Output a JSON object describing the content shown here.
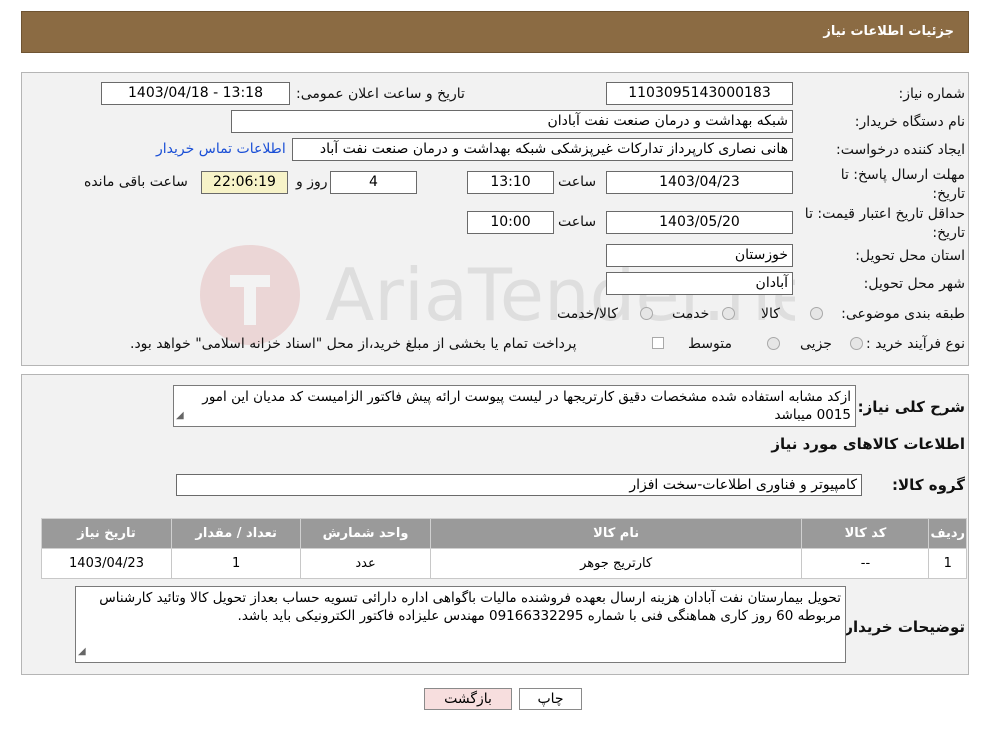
{
  "header": {
    "title": "جزئیات اطلاعات نیاز"
  },
  "need": {
    "number_label": "شماره نیاز:",
    "number": "1103095143000183",
    "announce_label": "تاریخ و ساعت اعلان عمومی:",
    "announce_value": "1403/04/18 - 13:18",
    "buyer_org_label": "نام دستگاه خریدار:",
    "buyer_org": "شبکه بهداشت و درمان صنعت نفت آبادان",
    "requester_label": "ایجاد کننده درخواست:",
    "requester": "هانی نصاری کارپرداز تدارکات غیرپزشکی شبکه بهداشت و درمان صنعت نفت آباد",
    "contact_link": "اطلاعات تماس خریدار",
    "deadline_label": "مهلت ارسال پاسخ: تا تاریخ:",
    "deadline_date": "1403/04/23",
    "time_label": "ساعت",
    "deadline_time": "13:10",
    "remaining_days": "4",
    "day_label": "روز و",
    "remaining_time": "22:06:19",
    "remaining_label": "ساعت باقی مانده",
    "validity_label": "حداقل تاریخ اعتبار قیمت: تا تاریخ:",
    "validity_date": "1403/05/20",
    "validity_time": "10:00",
    "province_label": "استان محل تحویل:",
    "province": "خوزستان",
    "city_label": "شهر محل تحویل:",
    "city": "آبادان",
    "category_label": "طبقه بندی موضوعی:",
    "category_options": [
      "کالا",
      "خدمت",
      "کالا/خدمت"
    ],
    "process_label": "نوع فرآیند خرید :",
    "process_options": [
      "جزیی",
      "متوسط"
    ],
    "payment_note": "پرداخت تمام یا بخشی از مبلغ خرید،از محل \"اسناد خزانه اسلامی\" خواهد بود."
  },
  "description": {
    "label": "شرح کلی نیاز:",
    "text": "ازکد مشابه استفاده شده مشخصات دقیق کارتریجها در لیست پیوست ارائه پیش فاکتور الزامیست کد مدیان این امور 0015 میباشد"
  },
  "goods": {
    "section_title": "اطلاعات کالاهای مورد نیاز",
    "group_label": "گروه کالا:",
    "group_value": "کامپیوتر و فناوری اطلاعات-سخت افزار",
    "columns": [
      "ردیف",
      "کد کالا",
      "نام کالا",
      "واحد شمارش",
      "تعداد / مقدار",
      "تاریخ نیاز"
    ],
    "rows": [
      [
        "1",
        "--",
        "کارتریج جوهر",
        "عدد",
        "1",
        "1403/04/23"
      ]
    ]
  },
  "buyer_notes": {
    "label": "توضیحات خریدار:",
    "text": "تحویل بیمارستان نفت آبادان هزینه ارسال بعهده فروشنده مالیات باگواهی اداره دارائی تسویه حساب بعداز تحویل کالا وتائید کارشناس مربوطه 60 روز کاری هماهنگی فنی با شماره 09166332295 مهندس علیزاده فاکتور الکترونیکی باید باشد."
  },
  "buttons": {
    "print": "چاپ",
    "back": "بازگشت"
  },
  "colors": {
    "header_bg": "#8b6b43",
    "table_header_bg": "#9a9a9a",
    "back_button_bg": "#f7dede",
    "link": "#1a4fd6"
  }
}
